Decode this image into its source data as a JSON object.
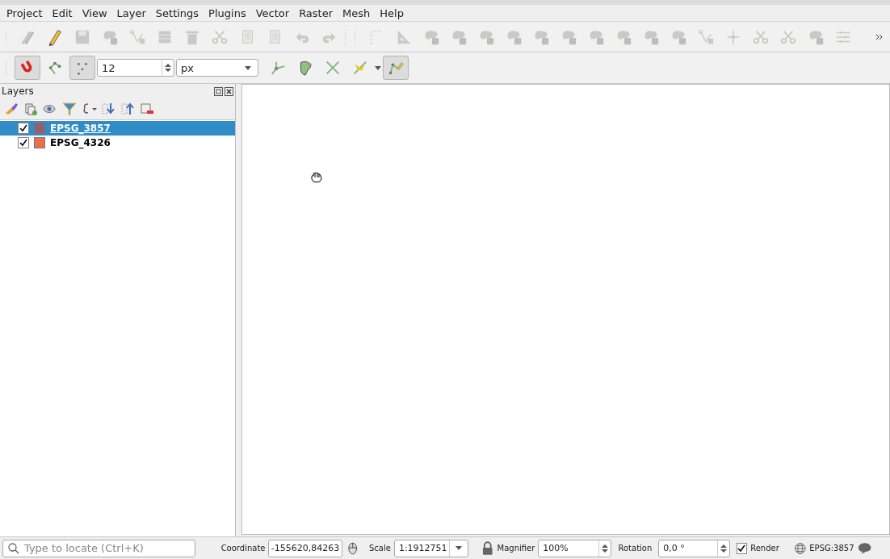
{
  "menu": [
    {
      "label": "Project"
    },
    {
      "label": "Edit"
    },
    {
      "label": "View"
    },
    {
      "label": "Layer"
    },
    {
      "label": "Settings"
    },
    {
      "label": "Plugins"
    },
    {
      "label": "Vector"
    },
    {
      "label": "Raster"
    },
    {
      "label": "Mesh"
    },
    {
      "label": "Help"
    }
  ],
  "snapping_toolbar": {
    "enabled": true,
    "tolerance": "12",
    "unit": "px",
    "tracing_enabled": true
  },
  "layers_panel": {
    "title": "Layers",
    "layers": [
      {
        "name": "EPSG_3857",
        "visible": true,
        "selected": true,
        "color": "#8f5f73"
      },
      {
        "name": "EPSG_4326",
        "visible": true,
        "selected": false,
        "color": "#e8714a"
      }
    ]
  },
  "status_bar": {
    "locator_placeholder": "Type to locate (Ctrl+K)",
    "coordinate_label": "Coordinate",
    "coordinate": "-155620,84263",
    "scale_label": "Scale",
    "scale": "1:1912751",
    "magnifier_label": "Magnifier",
    "magnifier": "100%",
    "rotation_label": "Rotation",
    "rotation": "0,0 °",
    "render_label": "Render",
    "render": true,
    "crs": "EPSG:3857"
  }
}
